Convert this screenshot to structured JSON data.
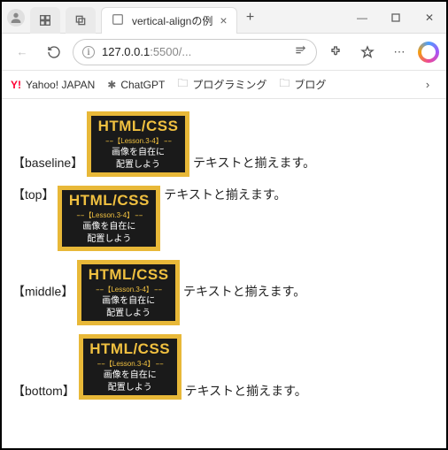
{
  "tab": {
    "title": "vertical-alignの例"
  },
  "url": {
    "host": "127.0.0.1",
    "port_path": ":5500/..."
  },
  "bookmarks": {
    "yahoo": "Yahoo! JAPAN",
    "chatgpt": "ChatGPT",
    "programming": "プログラミング",
    "blog": "ブログ"
  },
  "badge": {
    "title": "HTML/CSS",
    "lesson": "【Lesson.3-4】",
    "line1": "画像を自在に",
    "line2": "配置しよう"
  },
  "rows": {
    "baseline": {
      "label": "【baseline】",
      "text": "テキストと揃えます。"
    },
    "top": {
      "label": "【top】",
      "text": "テキストと揃えます。"
    },
    "middle": {
      "label": "【middle】",
      "text": "テキストと揃えます。"
    },
    "bottom": {
      "label": "【bottom】",
      "text": "テキストと揃えます。"
    }
  }
}
